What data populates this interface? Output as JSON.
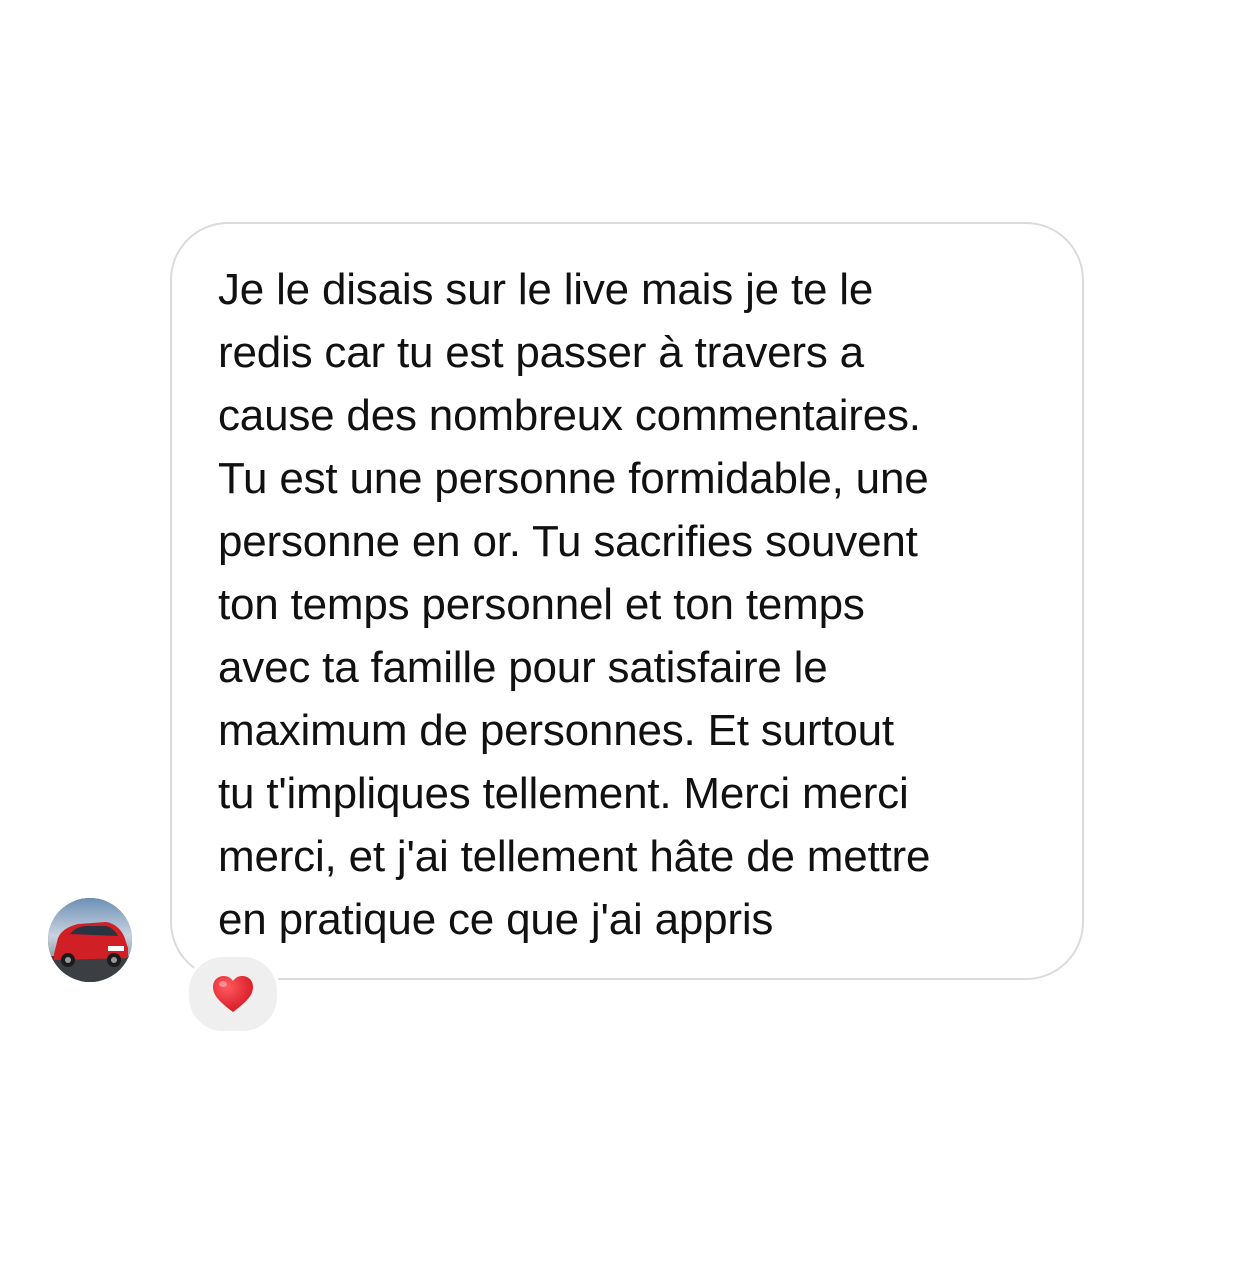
{
  "message": {
    "lines": [
      "Je le disais sur le live mais je te le",
      "redis car tu est passer à travers a",
      "cause des nombreux commentaires.",
      "Tu est une personne formidable, une",
      "personne en or. Tu sacrifies souvent",
      "ton temps personnel et ton temps",
      "avec ta famille pour satisfaire le",
      "maximum de personnes. Et surtout",
      "tu t'impliques tellement. Merci merci",
      "merci, et j'ai tellement hâte de mettre",
      "en pratique ce que j'ai appris"
    ]
  },
  "avatar": {
    "icon": "red-car-avatar"
  },
  "reaction": {
    "icon": "red-heart-icon",
    "color": "#e0202d"
  },
  "colors": {
    "bubble_border": "#dbdbdb",
    "text": "#111111",
    "reaction_bg": "#efefef"
  }
}
